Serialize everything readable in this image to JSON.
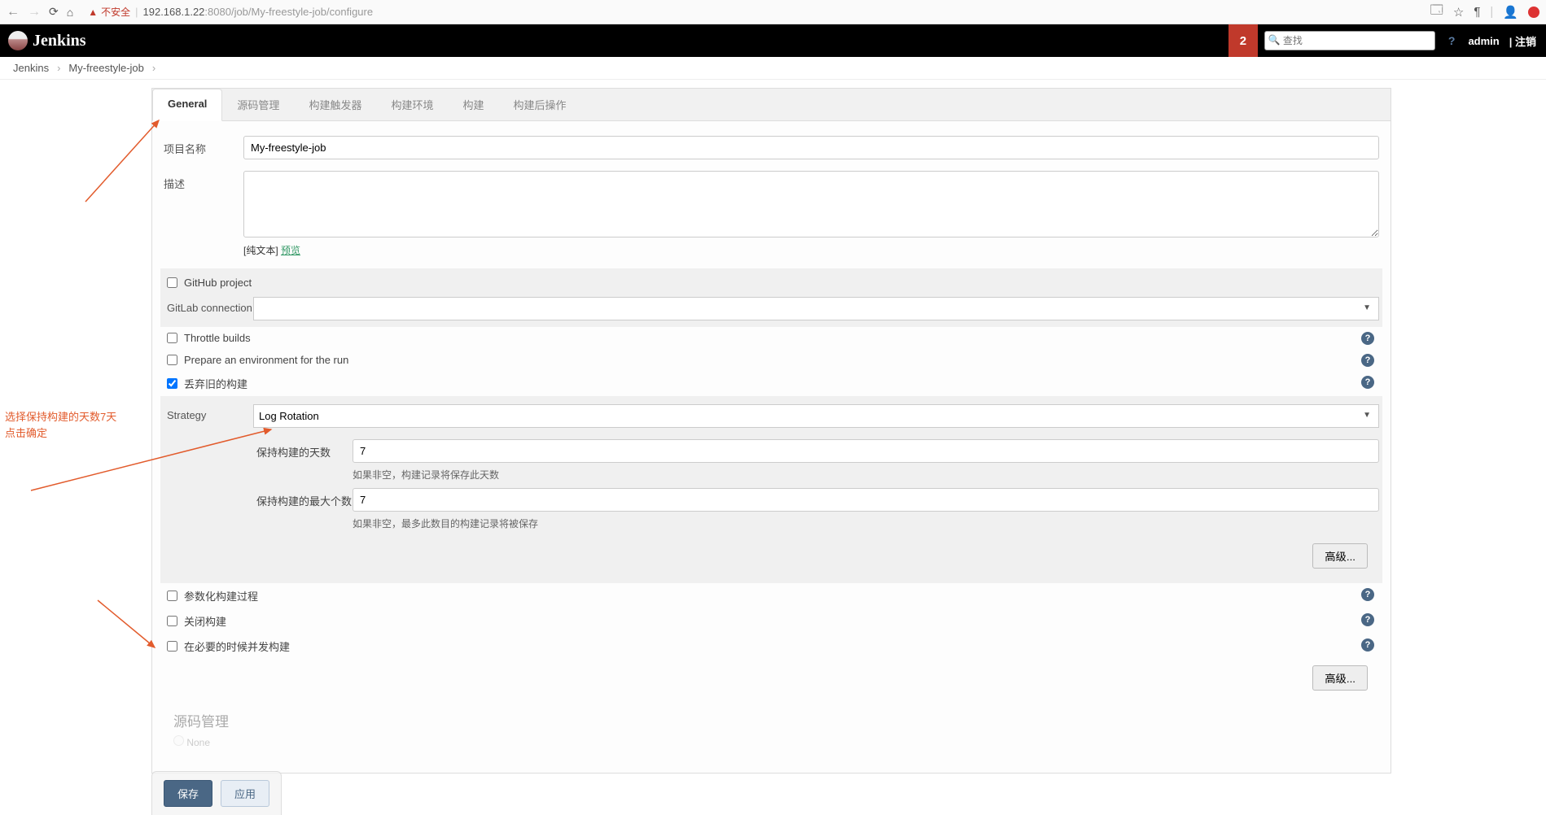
{
  "browser": {
    "insecure_label": "不安全",
    "url_prefix": "192.168.1.22",
    "url_port": ":8080",
    "url_path": "/job/My-freestyle-job/configure"
  },
  "header": {
    "brand": "Jenkins",
    "notif_count": "2",
    "search_placeholder": "查找",
    "user": "admin",
    "logout": "| 注销"
  },
  "breadcrumbs": {
    "root": "Jenkins",
    "job": "My-freestyle-job"
  },
  "tabs": {
    "general": "General",
    "scm": "源码管理",
    "triggers": "构建触发器",
    "env": "构建环境",
    "build": "构建",
    "post": "构建后操作"
  },
  "form": {
    "project_name_label": "项目名称",
    "project_name_value": "My-freestyle-job",
    "desc_label": "描述",
    "desc_hint_prefix": "[纯文本] ",
    "desc_hint_link": "预览",
    "github_project": "GitHub project",
    "gitlab_conn": "GitLab connection",
    "throttle": "Throttle builds",
    "prepare_env": "Prepare an environment for the run",
    "discard_old": "丢弃旧的构建",
    "strategy_label": "Strategy",
    "strategy_value": "Log Rotation",
    "days_label": "保持构建的天数",
    "days_value": "7",
    "days_hint": "如果非空，构建记录将保存此天数",
    "max_label": "保持构建的最大个数",
    "max_value": "7",
    "max_hint": "如果非空，最多此数目的构建记录将被保存",
    "advanced": "高级...",
    "param_build": "参数化构建过程",
    "disable_build": "关闭构建",
    "concurrent": "在必要的时候并发构建",
    "scm_section": "源码管理",
    "scm_none": "None"
  },
  "footer": {
    "save": "保存",
    "apply": "应用"
  },
  "annotations": {
    "text1": "选择保持构建的天数7天",
    "text2": "点击确定"
  }
}
